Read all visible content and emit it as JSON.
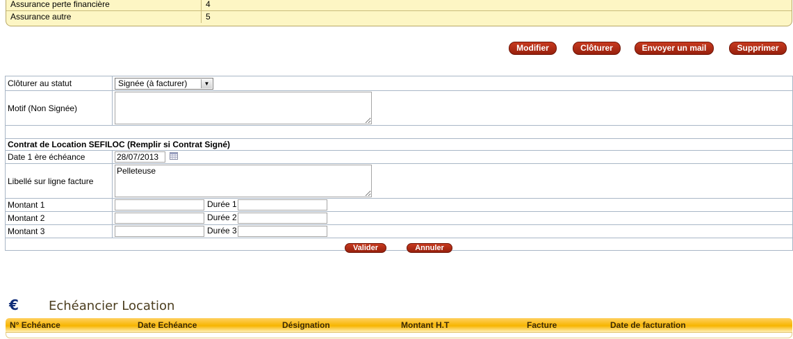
{
  "insurance": {
    "rows": [
      {
        "label": "Assurance perte financière",
        "value": "4"
      },
      {
        "label": "Assurance autre",
        "value": "5"
      }
    ]
  },
  "actions": {
    "modify": "Modifier",
    "close": "Clôturer",
    "send_mail": "Envoyer un mail",
    "delete": "Supprimer"
  },
  "closure": {
    "status_label": "Clôturer au statut",
    "status_value": "Signée (à facturer)",
    "reason_label": "Motif (Non Signée)",
    "reason_value": ""
  },
  "contract": {
    "section_title": "Contrat de Location SEFILOC (Remplir si Contrat Signé)",
    "first_due_label": "Date 1 ère échéance",
    "first_due_value": "28/07/2013",
    "invoice_line_label": "Libellé sur ligne facture",
    "invoice_line_value": "Pelleteuse",
    "amount1_label": "Montant 1",
    "amount2_label": "Montant 2",
    "amount3_label": "Montant 3",
    "duration1_label": "Durée 1",
    "duration2_label": "Durée 2",
    "duration3_label": "Durée 3",
    "validate": "Valider",
    "cancel": "Annuler"
  },
  "schedule": {
    "title": "Echéancier Location",
    "icon": "euro-icon",
    "columns": [
      "N° Echéance",
      "Date Echéance",
      "Désignation",
      "Montant H.T",
      "Facture",
      "Date de facturation"
    ]
  },
  "colors": {
    "button_red": "#b02a14",
    "header_orange": "#f7b500",
    "insurance_bg": "#fdf6c4"
  }
}
